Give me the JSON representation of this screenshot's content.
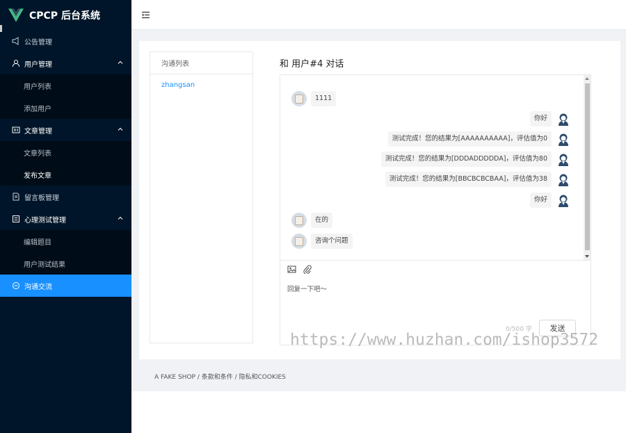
{
  "app": {
    "title": "CPCP 后台系统"
  },
  "sidebar": {
    "items": [
      {
        "label": "公告管理",
        "icon": "megaphone-icon"
      },
      {
        "label": "用户管理",
        "icon": "user-icon",
        "children": [
          "用户列表",
          "添加用户"
        ]
      },
      {
        "label": "文章管理",
        "icon": "article-icon",
        "children": [
          "文章列表",
          "发布文章"
        ]
      },
      {
        "label": "留言板管理",
        "icon": "message-board-icon"
      },
      {
        "label": "心理测试管理",
        "icon": "test-icon",
        "children": [
          "编辑题目",
          "用户测试结果"
        ]
      },
      {
        "label": "沟通交流",
        "icon": "chat-icon",
        "active": true
      }
    ]
  },
  "header": {
    "icon": "menu-fold-icon"
  },
  "conversation_list": {
    "title": "沟通列表",
    "items": [
      "zhangsan"
    ]
  },
  "chat": {
    "title": "和 用户#4 对话",
    "messages": [
      {
        "side": "left",
        "text": "1111"
      },
      {
        "side": "right",
        "text": "你好"
      },
      {
        "side": "right",
        "text": "测试完成！您的结果为[AAAAAAAAAA]，评估值为0"
      },
      {
        "side": "right",
        "text": "测试完成！您的结果为[DDDADDDDDA]，评估值为80"
      },
      {
        "side": "right",
        "text": "测试完成！您的结果为[BBCBCBCBAA]，评估值为38"
      },
      {
        "side": "right",
        "text": "你好"
      },
      {
        "side": "left",
        "text": "在的"
      },
      {
        "side": "left",
        "text": "咨询个问题"
      }
    ],
    "toolbar": [
      "image-icon",
      "attachment-icon"
    ],
    "input_placeholder": "回复一下吧～",
    "counter": "0/500 字",
    "send_label": "发送"
  },
  "footer": {
    "text": "A FAKE SHOP / 条款和条件 / 隐私和COOKIES"
  },
  "watermark": "https://www.huzhan.com/ishop3572",
  "colors": {
    "sidebar_bg": "#001529",
    "submenu_bg": "#000c17",
    "accent": "#1890ff"
  }
}
